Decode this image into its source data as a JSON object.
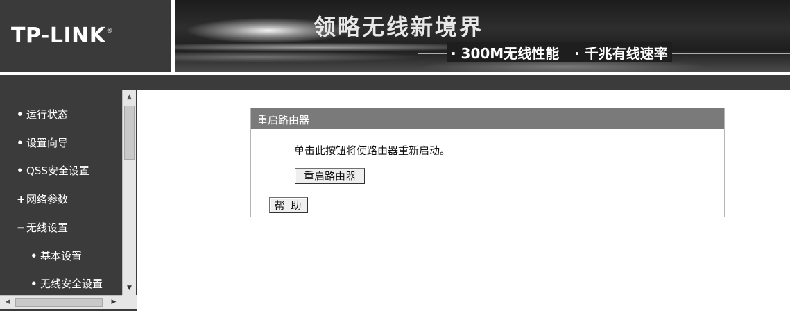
{
  "header": {
    "logo": "TP-LINK",
    "logo_mark": "®",
    "slogan": "领略无线新境界",
    "sub_slogan_1": "· 300M无线性能",
    "sub_slogan_2": "· 千兆有线速率"
  },
  "sidebar": {
    "items": [
      {
        "bullet": "•",
        "label": "运行状态"
      },
      {
        "bullet": "•",
        "label": "设置向导"
      },
      {
        "bullet": "•",
        "label": "QSS安全设置"
      },
      {
        "bullet": "+",
        "label": "网络参数"
      },
      {
        "bullet": "−",
        "label": "无线设置"
      },
      {
        "bullet": "•",
        "label": "基本设置"
      },
      {
        "bullet": "•",
        "label": "无线安全设置"
      }
    ],
    "scroll_up_icon": "▲",
    "scroll_down_icon": "▼",
    "scroll_left_icon": "◀",
    "scroll_right_icon": "▶"
  },
  "panel": {
    "title": "重启路由器",
    "description": "单击此按钮将使路由器重新启动。",
    "reboot_button": "重启路由器",
    "help_button": "帮 助"
  },
  "colors": {
    "sidebar_bg": "#3b3b3b",
    "panel_header_bg": "#7a7a7a",
    "logo_bg": "#3a3a3a"
  }
}
